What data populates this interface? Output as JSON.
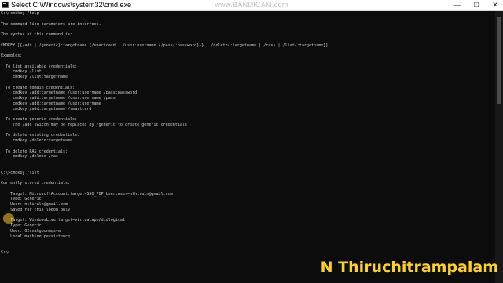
{
  "window": {
    "title": "Select C:\\Windows\\system32\\cmd.exe",
    "minimize_glyph": "—",
    "maximize_glyph": "☐",
    "close_glyph": "✕",
    "icon": "console-icon"
  },
  "watermark": "www.BANDICAM.com",
  "console": {
    "lines": [
      "C:\\>cmdkey /help",
      "",
      "The command line parameters are incorrect.",
      "",
      "The syntax of this command is:",
      "",
      "CMDKEY [{/add | /generic}:targetname {/smartcard | /user:username {/pass{:password}}} | /delete{:targetname | /ras} | /list{:targetname}]",
      "",
      "Examples:",
      "",
      "  To list available credentials:",
      "     cmdkey /list",
      "     cmdkey /list:targetname",
      "",
      "  To create domain credentials:",
      "     cmdkey /add:targetname /user:username /pass:password",
      "     cmdkey /add:targetname /user:username /pass",
      "     cmdkey /add:targetname /user:username",
      "     cmdkey /add:targetname /smartcard",
      "",
      "  To create generic credentials:",
      "     The /add switch may be replaced by /generic to create generic credentials",
      "",
      "  To delete existing credentials:",
      "     cmdkey /delete:targetname",
      "",
      "  To delete RAS credentials:",
      "     cmdkey /delete /ras",
      "",
      "",
      "C:\\>cmdkey /list",
      "",
      "Currently stored credentials:",
      "",
      "    Target: MicrosoftAccount:target=SSO_POP_User:user=nthiruln@gmail.com",
      "    Type: Generic",
      "    User: nthiruln@gmail.com",
      "    Saved for this logon only",
      "",
      "    Target: WindowsLive:target=virtualapp/didlogical",
      "    Type: Generic",
      "    User: 02rnahgponmqsva",
      "    Local machine persistence",
      "",
      "",
      "C:\\>"
    ]
  },
  "overlay": {
    "caption": "N Thiruchitrampalam"
  },
  "colors": {
    "console_bg": "#0c0c0c",
    "console_text": "#cccccc",
    "caption": "#ffd21f",
    "cursor_highlight": "#ffc828"
  }
}
